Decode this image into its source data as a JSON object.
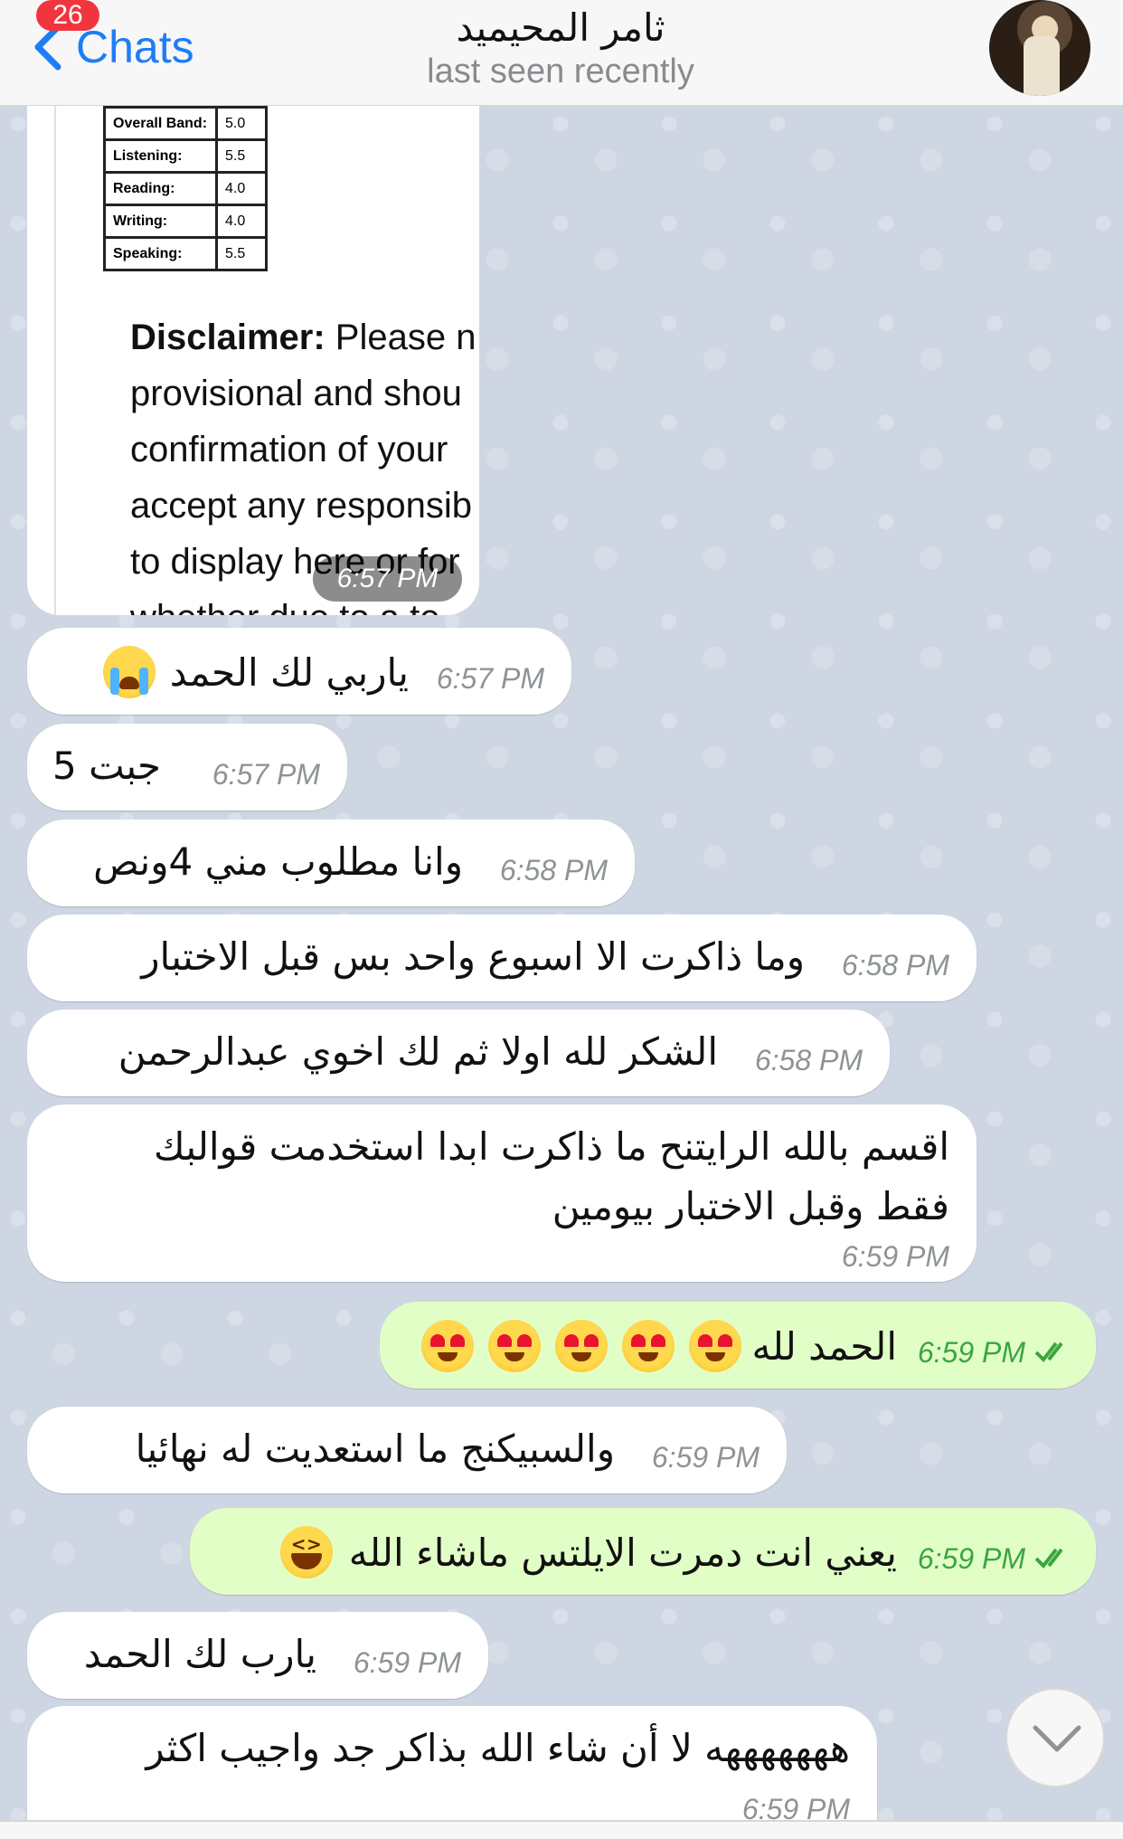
{
  "header": {
    "back_label": "Chats",
    "unread_badge": "26",
    "title": "ثامر المحيميد",
    "subtitle": "last seen recently"
  },
  "image_message": {
    "table": [
      {
        "label": "Overall Band:",
        "value": "5.0"
      },
      {
        "label": "Listening:",
        "value": "5.5"
      },
      {
        "label": "Reading:",
        "value": "4.0"
      },
      {
        "label": "Writing:",
        "value": "4.0"
      },
      {
        "label": "Speaking:",
        "value": "5.5"
      }
    ],
    "disclaimer_label": "Disclaimer:",
    "disclaimer_lines": [
      " Please n",
      "provisional and shou",
      "confirmation of your",
      "accept any responsib",
      "to display here or for",
      "whether due to a te"
    ],
    "time": "6:57 PM"
  },
  "messages": [
    {
      "dir": "in",
      "text": "ياربي لك الحمد",
      "emoji": [
        "loudly-crying-face"
      ],
      "time": "6:57 PM"
    },
    {
      "dir": "in",
      "text": "جبت 5",
      "time": "6:57 PM"
    },
    {
      "dir": "in",
      "text": "وانا مطلوب مني 4ونص",
      "time": "6:58 PM"
    },
    {
      "dir": "in",
      "text": "وما ذاكرت الا اسبوع واحد بس قبل الاختبار",
      "time": "6:58 PM"
    },
    {
      "dir": "in",
      "text": "الشكر لله اولا ثم لك اخوي عبدالرحمن",
      "time": "6:58 PM"
    },
    {
      "dir": "in",
      "text_lines": [
        "اقسم بالله الرايتنح ما ذاكرت ابدا استخدمت قوالبك",
        "فقط وقبل الاختبار بيومين"
      ],
      "time": "6:59 PM"
    },
    {
      "dir": "out",
      "text": "الحمد لله",
      "emoji": [
        "heart-eyes",
        "heart-eyes",
        "heart-eyes",
        "heart-eyes",
        "heart-eyes"
      ],
      "time": "6:59 PM"
    },
    {
      "dir": "in",
      "text": "والسبيكنج ما استعديت له نهائيا",
      "time": "6:59 PM"
    },
    {
      "dir": "out",
      "text": "يعني انت دمرت الايلتس ماشاء الله",
      "emoji": [
        "grinning-squinting-face"
      ],
      "time": "6:59 PM"
    },
    {
      "dir": "in",
      "text": "يارب لك الحمد",
      "time": "6:59 PM"
    },
    {
      "dir": "in",
      "text": "هههههههه لا أن شاء الله بذاكر جد واجيب اكثر",
      "time": "6:59 PM"
    }
  ],
  "colors": {
    "accent": "#1f7cf7",
    "badge": "#f2343f",
    "incoming_bubble": "#ffffff",
    "outgoing_bubble": "#e2fec7",
    "outgoing_time": "#3aa640"
  },
  "icons": {
    "back": "chevron-left-icon",
    "scroll_down": "chevron-down-icon",
    "read_receipt": "double-check-icon"
  }
}
